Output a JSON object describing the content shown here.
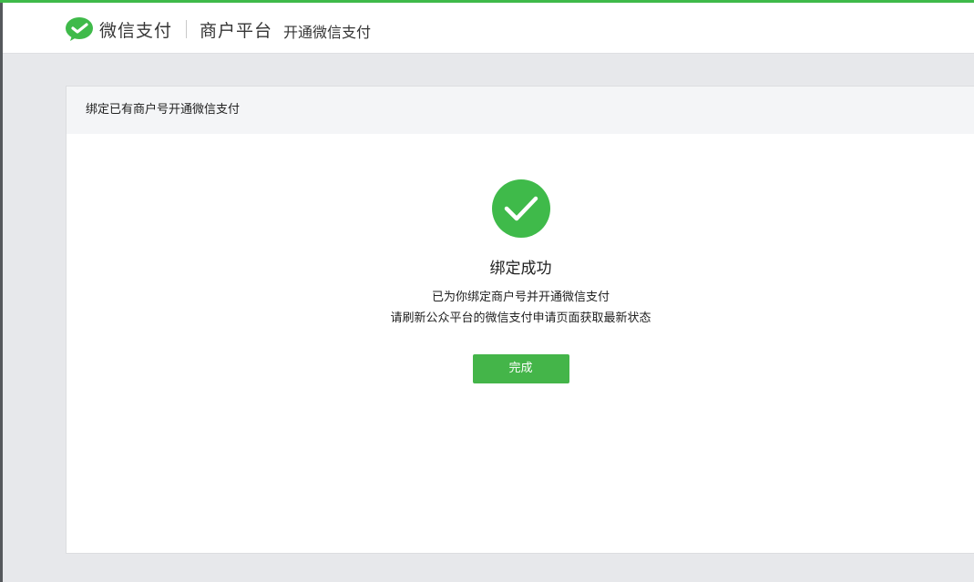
{
  "header": {
    "brand_name": "微信支付",
    "platform_name": "商户平台",
    "page_subtitle": "开通微信支付",
    "brand_color": "#3fba4a",
    "logo_icon": "wechat-pay-logo-icon"
  },
  "panel": {
    "title": "绑定已有商户号开通微信支付"
  },
  "result": {
    "status_icon": "check-circle-icon",
    "status_color": "#3fba4a",
    "title": "绑定成功",
    "line1": "已为你绑定商户号并开通微信支付",
    "line2": "请刷新公众平台的微信支付申请页面获取最新状态",
    "done_label": "完成",
    "button_color": "#44b549"
  }
}
